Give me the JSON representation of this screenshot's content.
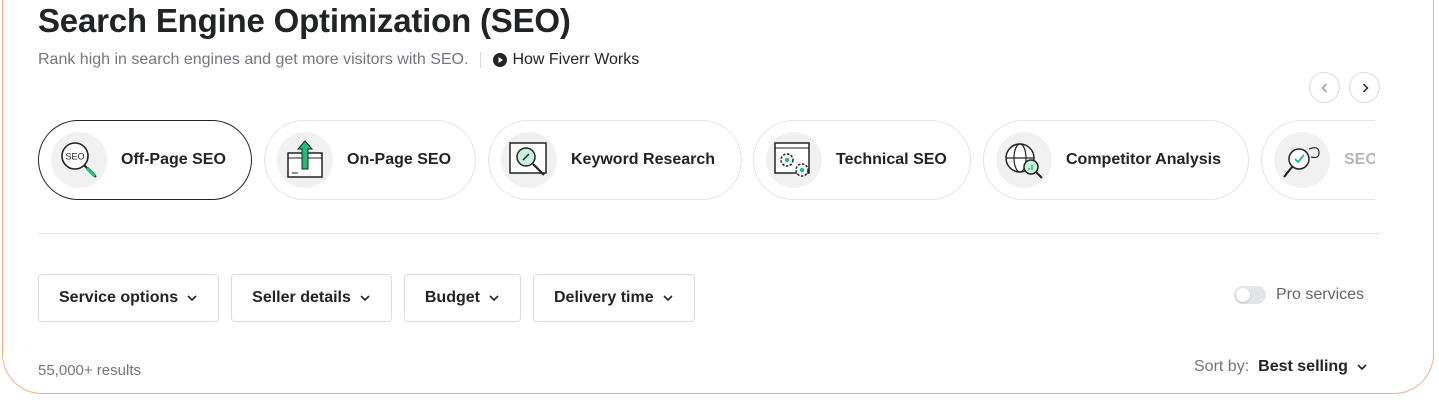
{
  "header": {
    "title": "Search Engine Optimization (SEO)",
    "subtitle": "Rank high in search engines and get more visitors with SEO.",
    "how_link": "How Fiverr Works"
  },
  "carousel": {
    "items": [
      {
        "label": "Off-Page SEO",
        "icon": "seo-magnifier-icon",
        "active": true
      },
      {
        "label": "On-Page SEO",
        "icon": "page-upload-icon"
      },
      {
        "label": "Keyword Research",
        "icon": "keyword-search-icon"
      },
      {
        "label": "Technical SEO",
        "icon": "gears-browser-icon"
      },
      {
        "label": "Competitor Analysis",
        "icon": "globe-analysis-icon"
      },
      {
        "label": "SEO",
        "icon": "seo-audit-icon"
      }
    ]
  },
  "filters": [
    {
      "label": "Service options"
    },
    {
      "label": "Seller details"
    },
    {
      "label": "Budget"
    },
    {
      "label": "Delivery time"
    }
  ],
  "pro_toggle": {
    "label": "Pro services",
    "on": false
  },
  "results": {
    "count": "55,000+ results"
  },
  "sort": {
    "label": "Sort by:",
    "value": "Best selling"
  },
  "colors": {
    "accent_green": "#1dbf73",
    "frame": "#f3b08c",
    "text": "#222325",
    "muted": "#74767e"
  }
}
